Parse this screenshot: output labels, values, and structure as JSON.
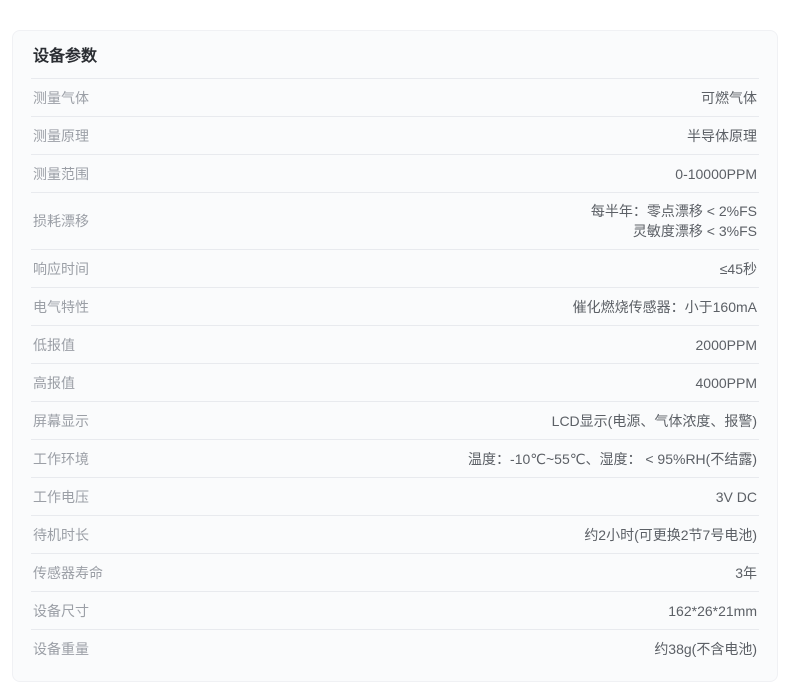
{
  "card": {
    "title": "设备参数",
    "rows": [
      {
        "label": "测量气体",
        "value": "可燃气体"
      },
      {
        "label": "测量原理",
        "value": "半导体原理"
      },
      {
        "label": "测量范围",
        "value": "0-10000PPM"
      },
      {
        "label": "损耗漂移",
        "value": "每半年：零点漂移 < 2%FS\n灵敏度漂移 < 3%FS"
      },
      {
        "label": "响应时间",
        "value": "≤45秒"
      },
      {
        "label": "电气特性",
        "value": "催化燃烧传感器：小于160mA"
      },
      {
        "label": "低报值",
        "value": "2000PPM"
      },
      {
        "label": "高报值",
        "value": "4000PPM"
      },
      {
        "label": "屏幕显示",
        "value": "LCD显示(电源、气体浓度、报警)"
      },
      {
        "label": "工作环境",
        "value": "温度：-10℃~55℃、湿度： < 95%RH(不结露)"
      },
      {
        "label": "工作电压",
        "value": "3V DC"
      },
      {
        "label": "待机时长",
        "value": "约2小时(可更换2节7号电池)"
      },
      {
        "label": "传感器寿命",
        "value": "3年"
      },
      {
        "label": "设备尺寸",
        "value": "162*26*21mm"
      },
      {
        "label": "设备重量",
        "value": "约38g(不含电池)"
      }
    ]
  }
}
